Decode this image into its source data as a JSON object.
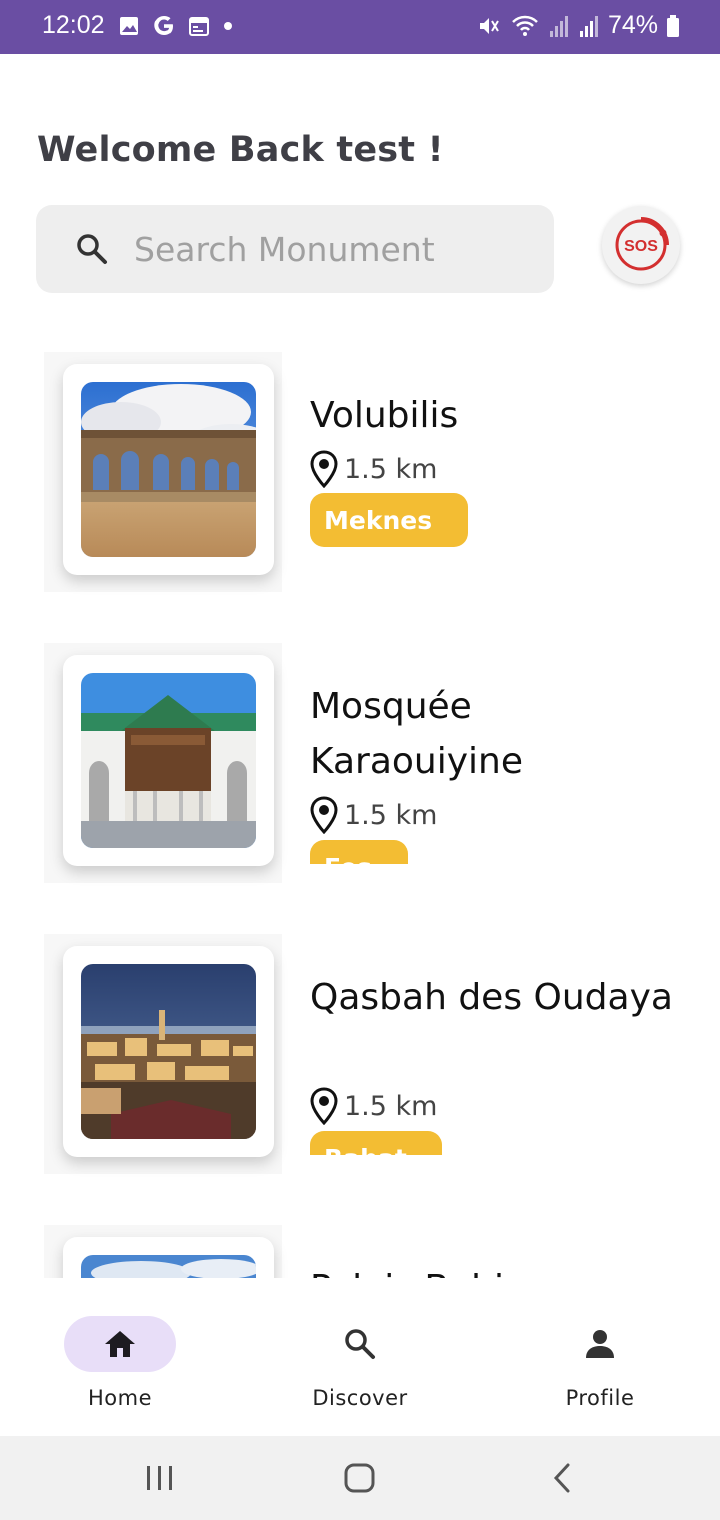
{
  "status_bar": {
    "time": "12:02",
    "battery": "74%",
    "left_icons": [
      "image-icon",
      "google-icon",
      "calendar-icon",
      "dot-icon"
    ],
    "right_icons": [
      "mute-icon",
      "wifi-icon",
      "signal-icon",
      "signal-icon",
      "battery-icon"
    ],
    "bg_color": "#6a4ea3"
  },
  "header": {
    "welcome": "Welcome Back test !"
  },
  "search": {
    "placeholder": "Search Monument"
  },
  "sos": {
    "label": "SOS"
  },
  "monuments": [
    {
      "name": "Volubilis",
      "distance": "1.5 km",
      "city": "Meknes"
    },
    {
      "name": "Mosquée Karaouiyine",
      "distance": "1.5 km",
      "city": "Fes"
    },
    {
      "name": "Qasbah des Oudaya",
      "distance": "1.5 km",
      "city": "Rabat"
    },
    {
      "name": "Palais Bahia",
      "distance": "",
      "city": ""
    }
  ],
  "nav": {
    "items": [
      {
        "label": "Home",
        "icon": "home-icon",
        "active": true
      },
      {
        "label": "Discover",
        "icon": "search-icon",
        "active": false
      },
      {
        "label": "Profile",
        "icon": "person-icon",
        "active": false
      }
    ]
  },
  "colors": {
    "accent": "#f3bd33",
    "nav_active_bg": "#e8def8",
    "sos_red": "#d32f2f"
  }
}
